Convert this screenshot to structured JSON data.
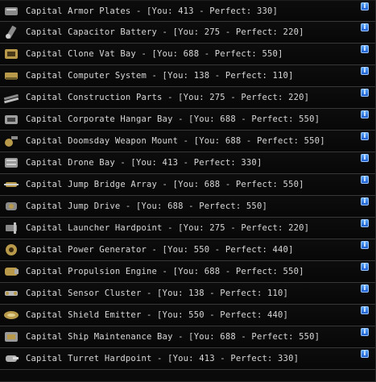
{
  "blueprint_components": {
    "items": [
      {
        "label": "Capital Armor Plates - [You: 413 - Perfect: 330]",
        "icon": "armor-plates-icon"
      },
      {
        "label": "Capital Capacitor Battery - [You: 275 - Perfect: 220]",
        "icon": "capacitor-battery-icon"
      },
      {
        "label": "Capital Clone Vat Bay - [You: 688 - Perfect: 550]",
        "icon": "clone-vat-bay-icon"
      },
      {
        "label": "Capital Computer System - [You: 138 - Perfect: 110]",
        "icon": "computer-system-icon"
      },
      {
        "label": "Capital Construction Parts - [You: 275 - Perfect: 220]",
        "icon": "construction-parts-icon"
      },
      {
        "label": "Capital Corporate Hangar Bay - [You: 688 - Perfect: 550]",
        "icon": "corporate-hangar-bay-icon"
      },
      {
        "label": "Capital Doomsday Weapon Mount - [You: 688 - Perfect: 550]",
        "icon": "doomsday-weapon-mount-icon"
      },
      {
        "label": "Capital Drone Bay - [You: 413 - Perfect: 330]",
        "icon": "drone-bay-icon"
      },
      {
        "label": "Capital Jump Bridge Array - [You: 688 - Perfect: 550]",
        "icon": "jump-bridge-array-icon"
      },
      {
        "label": "Capital Jump Drive - [You: 688 - Perfect: 550]",
        "icon": "jump-drive-icon"
      },
      {
        "label": "Capital Launcher Hardpoint - [You: 275 - Perfect: 220]",
        "icon": "launcher-hardpoint-icon"
      },
      {
        "label": "Capital Power Generator - [You: 550 - Perfect: 440]",
        "icon": "power-generator-icon"
      },
      {
        "label": "Capital Propulsion Engine - [You: 688 - Perfect: 550]",
        "icon": "propulsion-engine-icon"
      },
      {
        "label": "Capital Sensor Cluster - [You: 138 - Perfect: 110]",
        "icon": "sensor-cluster-icon"
      },
      {
        "label": "Capital Shield Emitter - [You: 550 - Perfect: 440]",
        "icon": "shield-emitter-icon"
      },
      {
        "label": "Capital Ship Maintenance Bay - [You: 688 - Perfect: 550]",
        "icon": "ship-maintenance-bay-icon"
      },
      {
        "label": "Capital Turret Hardpoint - [You: 413 - Perfect: 330]",
        "icon": "turret-hardpoint-icon"
      }
    ],
    "info_glyph": "i"
  },
  "colors": {
    "background": "#0a0a0a",
    "text": "#d8d8d8",
    "row_divider": "#383838",
    "info_button": "#2f7de8",
    "component_metal": "#8a8a8a",
    "component_gold": "#b89a4a"
  }
}
